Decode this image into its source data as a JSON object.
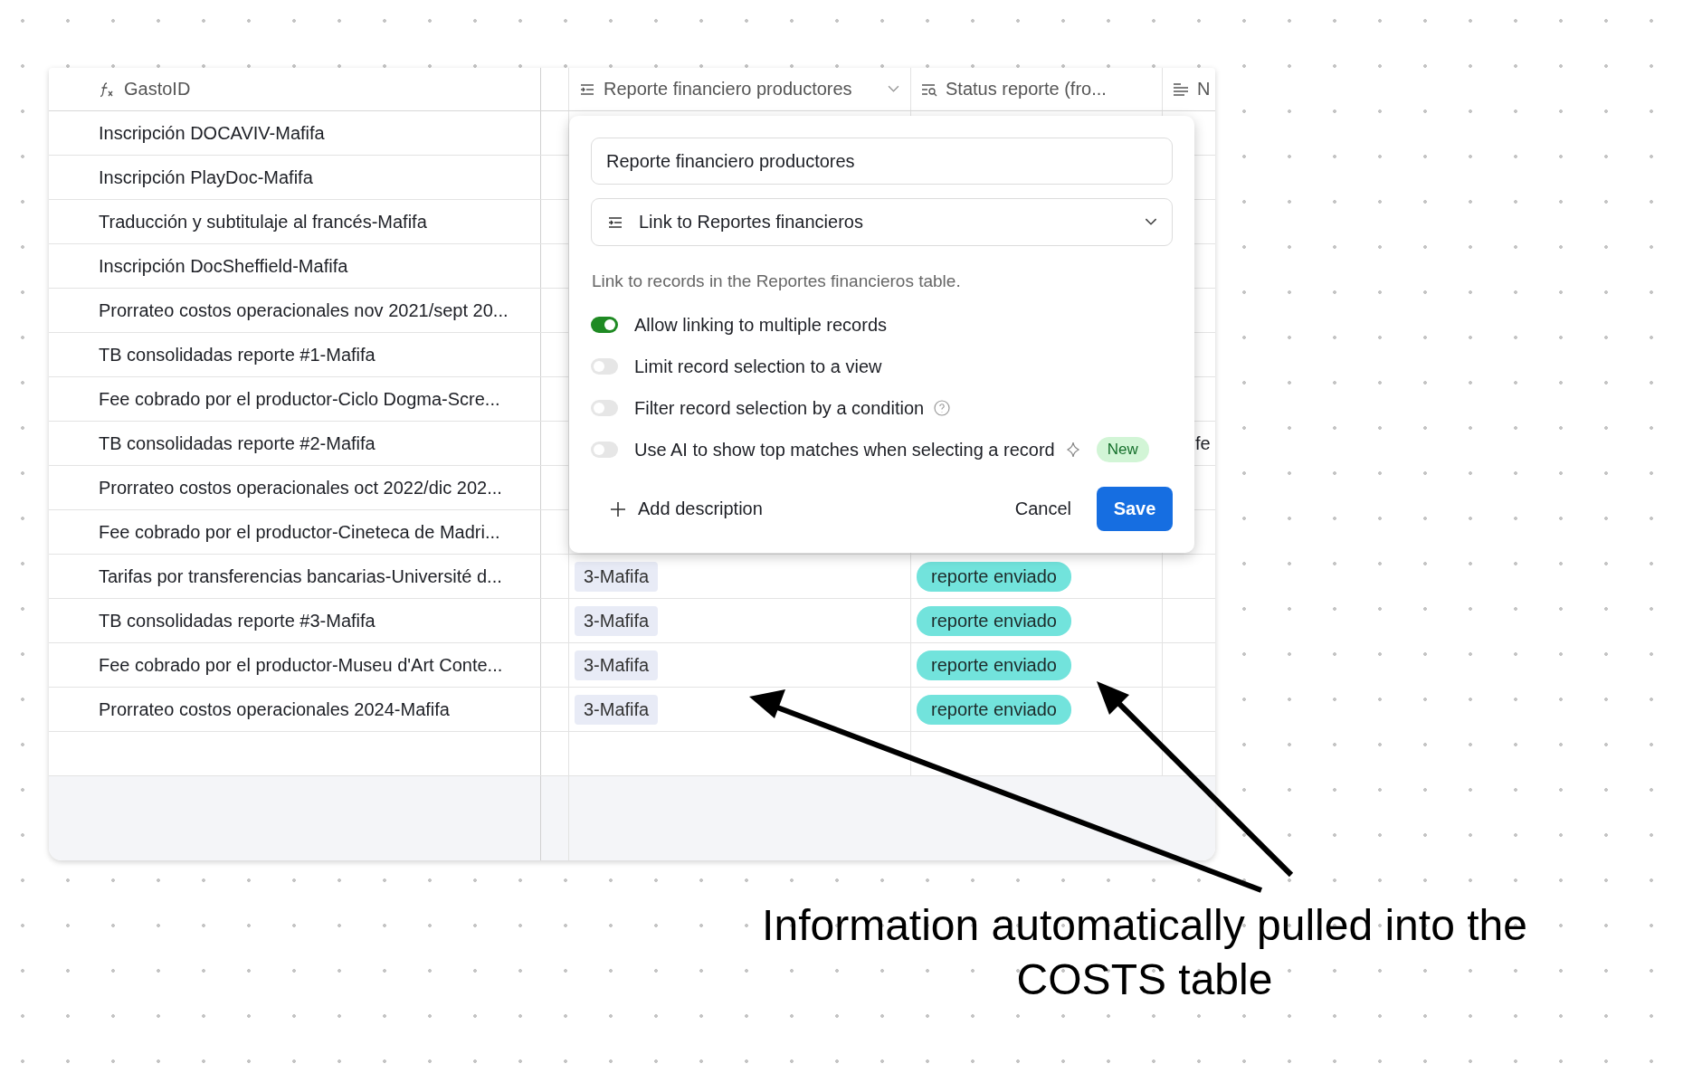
{
  "table": {
    "columns": [
      {
        "label": "GastoID",
        "kind": "formula",
        "menu": false
      },
      {
        "label": "Reporte financiero productores",
        "kind": "link",
        "menu": true
      },
      {
        "label": "Status reporte (fro...",
        "kind": "lookup",
        "menu": false
      },
      {
        "label": "N",
        "kind": "text"
      }
    ],
    "rows": [
      {
        "gasto_id": "Inscripción DOCAVIV-Mafifa"
      },
      {
        "gasto_id": "Inscripción PlayDoc-Mafifa"
      },
      {
        "gasto_id": "Traducción y subtitulaje al francés-Mafifa"
      },
      {
        "gasto_id": "Inscripción DocSheffield-Mafifa"
      },
      {
        "gasto_id": "Prorrateo costos operacionales nov 2021/sept 20..."
      },
      {
        "gasto_id": "TB consolidadas reporte #1-Mafifa"
      },
      {
        "gasto_id": "Fee cobrado por el productor-Ciclo Dogma-Scre..."
      },
      {
        "gasto_id": "TB consolidadas reporte #2-Mafifa",
        "column_4": "fe"
      },
      {
        "gasto_id": "Prorrateo costos operacionales oct 2022/dic 202..."
      },
      {
        "gasto_id": "Fee cobrado por el productor-Cineteca de Madri..."
      },
      {
        "gasto_id": "Tarifas por transferencias bancarias-Université d...",
        "reporte": "3-Mafifa",
        "status": "reporte enviado"
      },
      {
        "gasto_id": "TB consolidadas reporte #3-Mafifa",
        "reporte": "3-Mafifa",
        "status": "reporte enviado"
      },
      {
        "gasto_id": "Fee cobrado por el productor-Museu d'Art Conte...",
        "reporte": "3-Mafifa",
        "status": "reporte enviado"
      },
      {
        "gasto_id": "Prorrateo costos operacionales 2024-Mafifa",
        "reporte": "3-Mafifa",
        "status": "reporte enviado"
      }
    ]
  },
  "field_editor": {
    "field_name": "Reporte financiero productores",
    "field_type": "Link to Reportes financieros",
    "description": "Link to records in the Reportes financieros table.",
    "options": [
      {
        "label": "Allow linking to multiple records",
        "on": true,
        "help": false
      },
      {
        "label": "Limit record selection to a view",
        "on": false,
        "help": false
      },
      {
        "label": "Filter record selection by a condition",
        "on": false,
        "help": true
      },
      {
        "label": "Use AI to show top matches when selecting a record",
        "on": false,
        "help": false,
        "sparkle": true,
        "badge": "New"
      }
    ],
    "add_description": "Add description",
    "cancel": "Cancel",
    "save": "Save"
  },
  "annotation": {
    "text": "Information automatically pulled into the COSTS table"
  }
}
